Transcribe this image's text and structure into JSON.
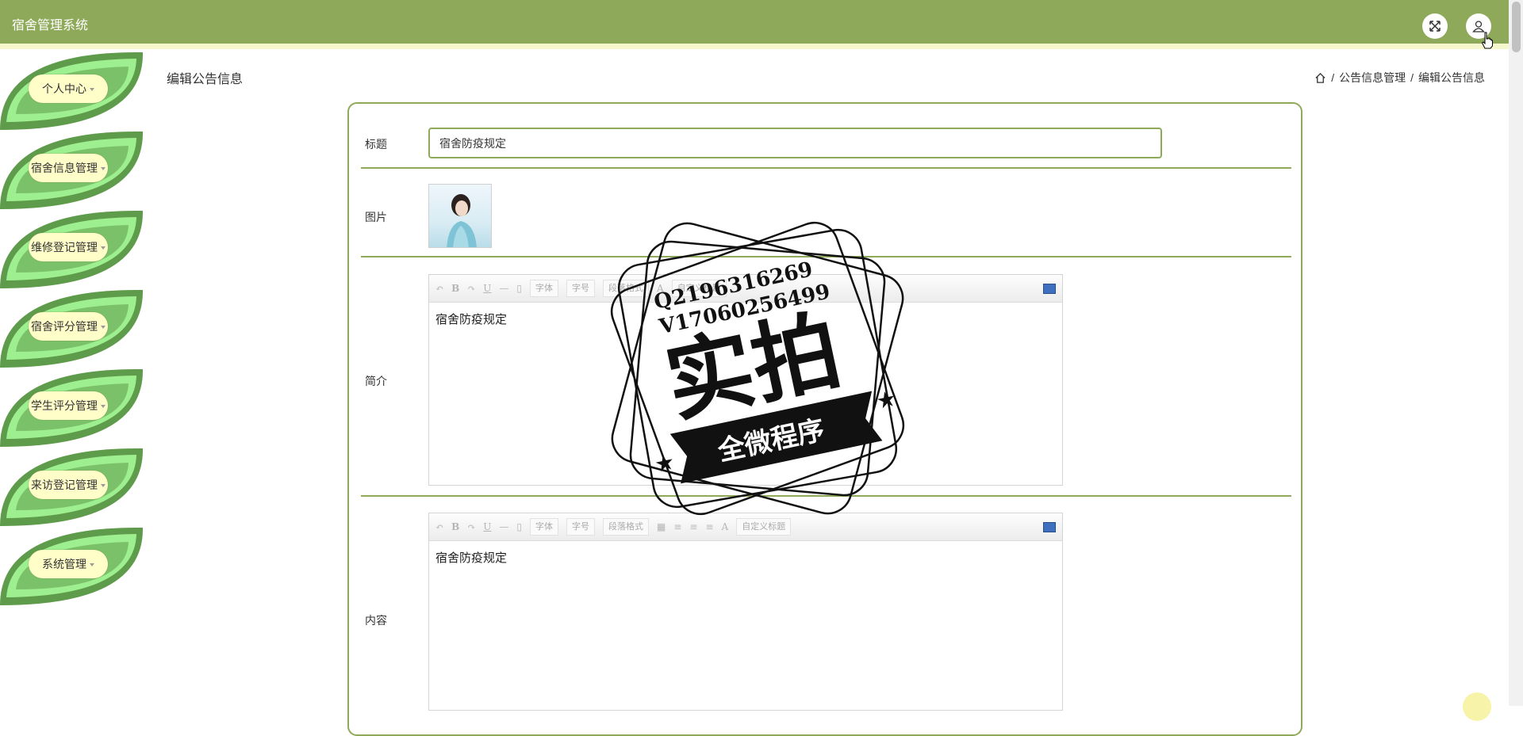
{
  "app": {
    "title": "宿舍管理系统"
  },
  "header": {
    "fullscreen_icon": "expand-arrows-icon",
    "user_icon": "user-icon"
  },
  "sidebar": {
    "items": [
      {
        "label": "个人中心"
      },
      {
        "label": "宿舍信息管理"
      },
      {
        "label": "维修登记管理"
      },
      {
        "label": "宿舍评分管理"
      },
      {
        "label": "学生评分管理"
      },
      {
        "label": "来访登记管理"
      },
      {
        "label": "系统管理"
      }
    ]
  },
  "page": {
    "title": "编辑公告信息",
    "breadcrumb": [
      "公告信息管理",
      "编辑公告信息"
    ]
  },
  "form": {
    "title_label": "标题",
    "title_value": "宿舍防疫规定",
    "image_label": "图片",
    "summary_label": "简介",
    "summary_value": "宿舍防疫规定",
    "content_label": "内容",
    "content_value": "宿舍防疫规定"
  },
  "editor_toolbar": {
    "font_family": "字体",
    "font_size": "字号",
    "paragraph": "段落格式",
    "custom_title": "自定义标题"
  },
  "watermark": {
    "line1": "Q2196316269",
    "line2": "V17060256499",
    "big": "实拍",
    "banner": "全微程序"
  },
  "colors": {
    "topbar": "#8fa95a",
    "leaf_dark": "#5e9b4b",
    "leaf_light": "#9eef8f",
    "label_bg": "#fffdc8",
    "accent_border": "#8fa95a"
  }
}
